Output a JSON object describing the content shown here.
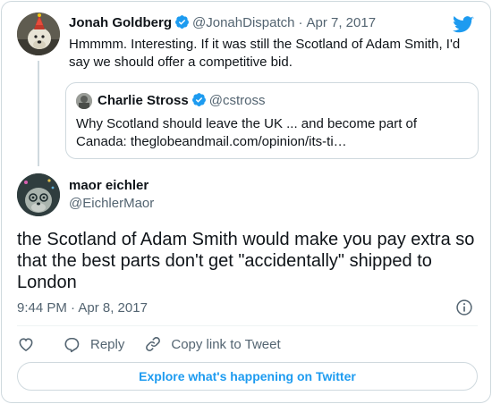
{
  "parent_tweet": {
    "author_name": "Jonah Goldberg",
    "handle": "@JonahDispatch",
    "separator": "·",
    "date": "Apr 7, 2017",
    "text": "Hmmmm. Interesting. If it was still the Scotland of Adam Smith, I'd say we should offer a competitive bid."
  },
  "quoted_tweet": {
    "author_name": "Charlie Stross",
    "handle": "@cstross",
    "text": "Why Scotland should leave the UK ... and become part of Canada: theglobeandmail.com/opinion/its-ti…"
  },
  "main_tweet": {
    "author_name": "maor eichler",
    "handle": "@EichlerMaor",
    "text": "the Scotland of Adam Smith would make you pay extra so that the best parts don't get \"accidentally\" shipped to London",
    "timestamp": "9:44 PM · Apr 8, 2017"
  },
  "actions": {
    "like_icon": "heart-icon",
    "reply_label": "Reply",
    "copy_label": "Copy link to Tweet"
  },
  "footer": {
    "explore_label": "Explore what's happening on Twitter"
  },
  "colors": {
    "brand": "#1d9bf0",
    "muted_text": "#536471",
    "border": "#cfd9de"
  }
}
